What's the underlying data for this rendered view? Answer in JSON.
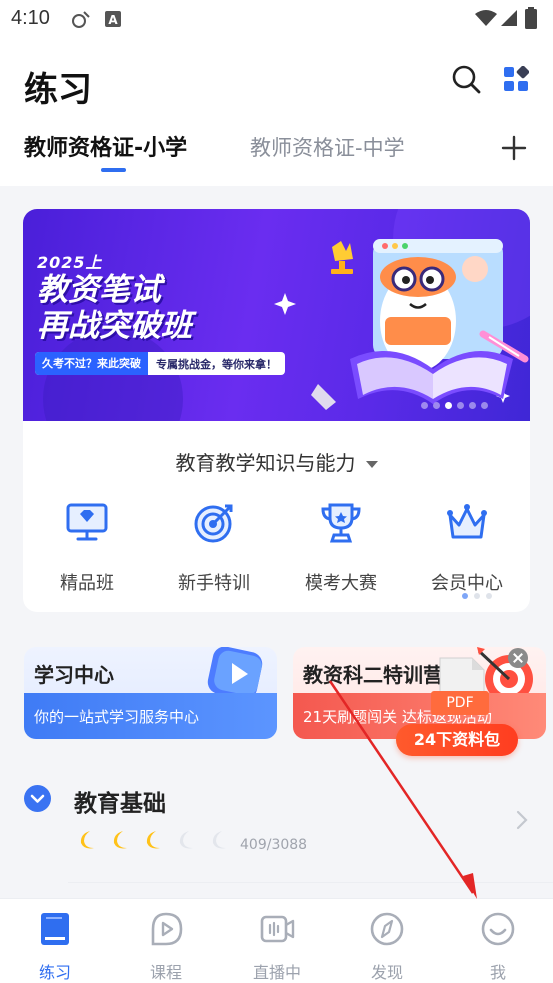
{
  "status_bar": {
    "time": "4:10"
  },
  "header": {
    "title": "练习"
  },
  "tabs": [
    {
      "label": "教师资格证-小学",
      "active": true
    },
    {
      "label": "教师资格证-中学",
      "active": false
    }
  ],
  "banner": {
    "year": "2025上",
    "headline_1": "教资笔试",
    "headline_2": "再战突破班",
    "tag_a": "久考不过？来此突破",
    "tag_b": "专属挑战金，等你来拿！",
    "slide_count": 6,
    "active_slide": 3
  },
  "subject_selector": {
    "label": "教育教学知识与能力"
  },
  "entries": [
    {
      "label": "精品班",
      "icon": "monitor-diamond-icon"
    },
    {
      "label": "新手特训",
      "icon": "target-icon"
    },
    {
      "label": "模考大赛",
      "icon": "trophy-icon"
    },
    {
      "label": "会员中心",
      "icon": "crown-icon"
    }
  ],
  "promos": {
    "left": {
      "title": "学习中心",
      "subtitle": "你的一站式学习服务中心"
    },
    "right": {
      "title": "教资科二特训营",
      "subtitle": "21天刷题闯关 达标返现活动"
    }
  },
  "popup": {
    "pdf_label": "PDF",
    "pill_label": "24下资料包"
  },
  "section": {
    "title": "教育基础",
    "progress": "409/3088",
    "moons_filled": 3,
    "moons_total": 5
  },
  "bottom_nav": [
    {
      "label": "练习",
      "active": true,
      "icon": "book-icon"
    },
    {
      "label": "课程",
      "active": false,
      "icon": "play-bubble-icon"
    },
    {
      "label": "直播中",
      "active": false,
      "icon": "live-video-icon"
    },
    {
      "label": "发现",
      "active": false,
      "icon": "compass-icon"
    },
    {
      "label": "我",
      "active": false,
      "icon": "smile-face-icon"
    }
  ],
  "colors": {
    "accent": "#2f6ef0",
    "banner": "#5a2ae8",
    "annotation_arrow": "#e32626"
  }
}
